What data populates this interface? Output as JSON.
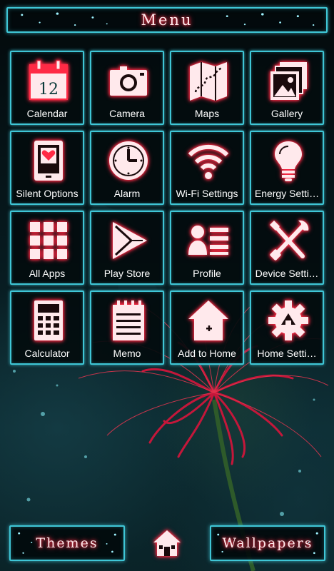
{
  "header": {
    "title": "Menu"
  },
  "apps": [
    {
      "label": "Calendar",
      "icon": "calendar-icon",
      "date": "12"
    },
    {
      "label": "Camera",
      "icon": "camera-icon"
    },
    {
      "label": "Maps",
      "icon": "map-icon"
    },
    {
      "label": "Gallery",
      "icon": "gallery-icon"
    },
    {
      "label": "Silent Options",
      "icon": "silent-tablet-icon"
    },
    {
      "label": "Alarm",
      "icon": "clock-icon"
    },
    {
      "label": "Wi-Fi Settings",
      "icon": "wifi-icon"
    },
    {
      "label": "Energy Setti…",
      "icon": "lightbulb-icon"
    },
    {
      "label": "All Apps",
      "icon": "grid-icon"
    },
    {
      "label": "Play Store",
      "icon": "play-store-icon"
    },
    {
      "label": "Profile",
      "icon": "profile-card-icon"
    },
    {
      "label": "Device Setti…",
      "icon": "tools-icon"
    },
    {
      "label": "Calculator",
      "icon": "calculator-icon"
    },
    {
      "label": "Memo",
      "icon": "notepad-icon"
    },
    {
      "label": "Add to Home",
      "icon": "add-home-icon"
    },
    {
      "label": "Home Setti…",
      "icon": "gear-icon"
    }
  ],
  "footer": {
    "themes_label": "Themes",
    "wallpapers_label": "Wallpapers",
    "home_icon": "house-icon"
  },
  "colors": {
    "accent_frame": "#3fc6d6",
    "icon_neon": "#ff2a45",
    "background": "#061418"
  }
}
